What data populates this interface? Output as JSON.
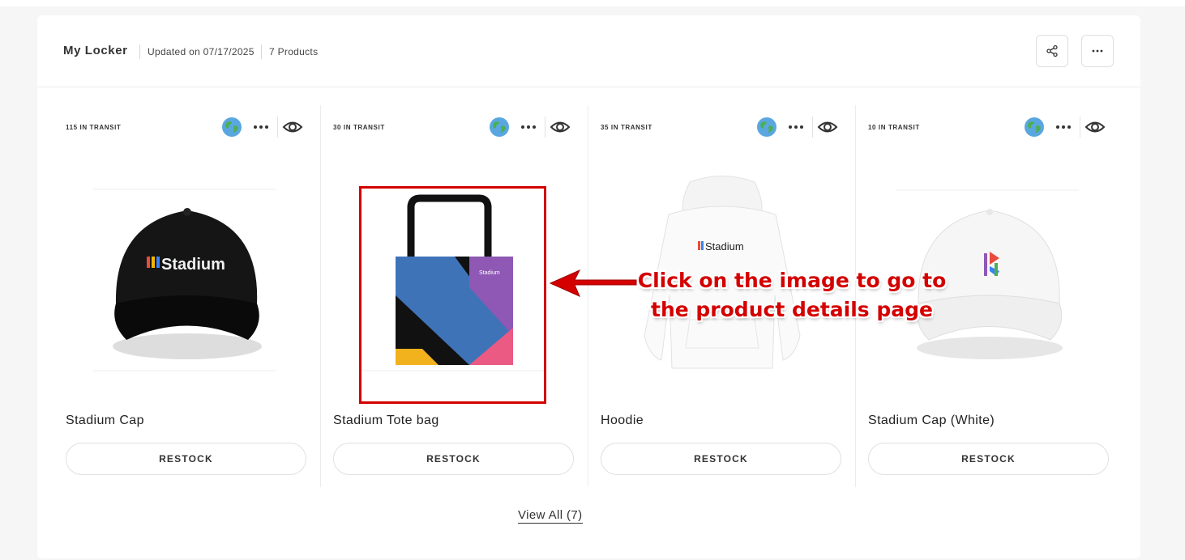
{
  "header": {
    "title": "My Locker",
    "updated": "Updated on 07/17/2025",
    "count": "7 Products"
  },
  "products": [
    {
      "transit": "115 IN TRANSIT",
      "name": "Stadium Cap",
      "button": "RESTOCK",
      "logo_text": "Stadium"
    },
    {
      "transit": "30 IN TRANSIT",
      "name": "Stadium Tote bag",
      "button": "RESTOCK",
      "logo_text": "Stadium"
    },
    {
      "transit": "35 IN TRANSIT",
      "name": "Hoodie",
      "button": "RESTOCK",
      "logo_text": "Stadium"
    },
    {
      "transit": "10 IN TRANSIT",
      "name": "Stadium Cap (White)",
      "button": "RESTOCK"
    }
  ],
  "view_all": "View All (7)",
  "annotation": {
    "line1": "Click on the image to go to",
    "line2": "the product details page"
  },
  "colors": {
    "annotation": "#d40000",
    "background": "#f6f6f6",
    "panel": "#ffffff"
  },
  "icons": [
    "share-icon",
    "more-horizontal-icon",
    "globe-icon",
    "eye-icon"
  ]
}
